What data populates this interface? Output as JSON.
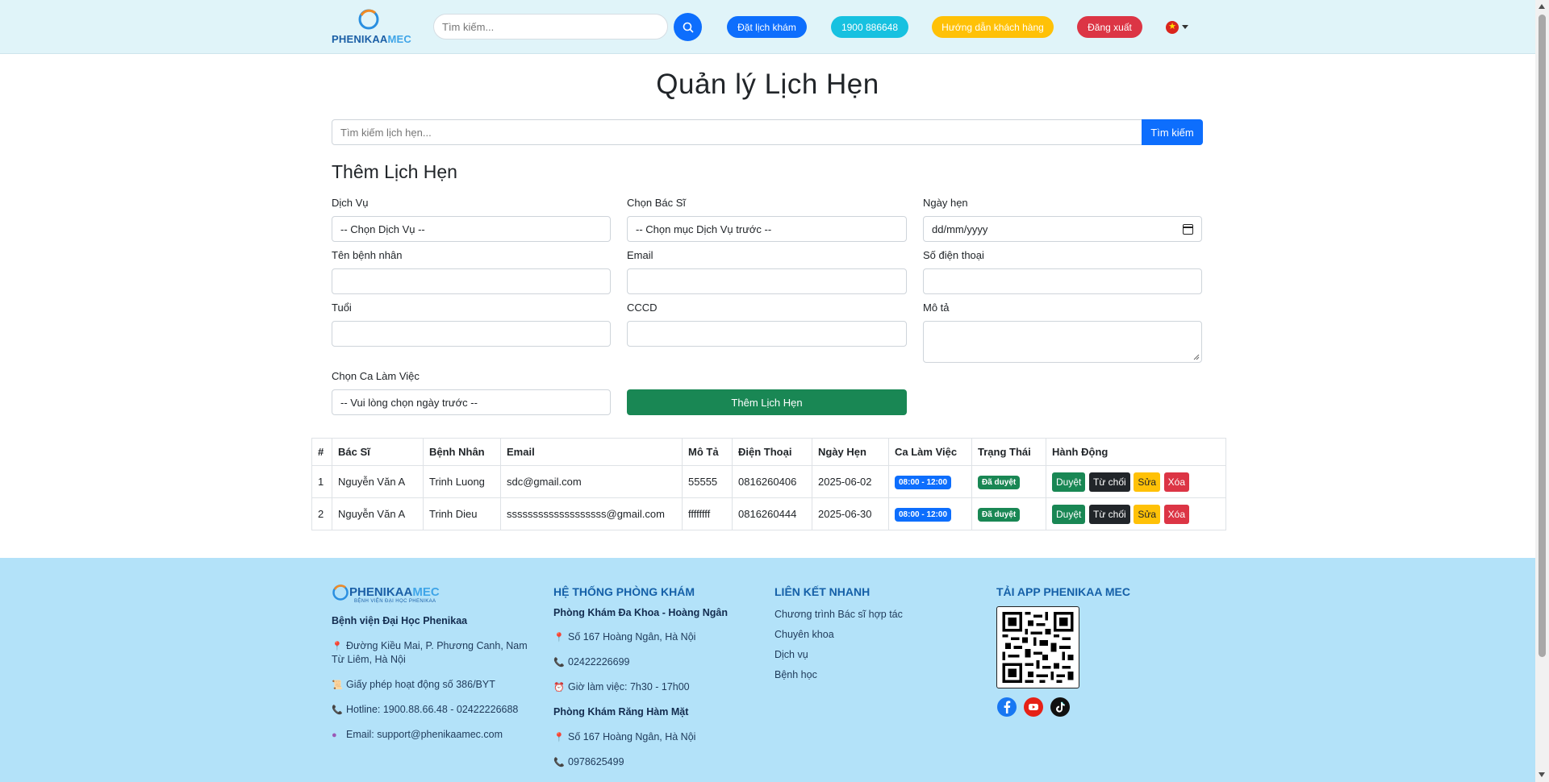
{
  "header": {
    "logo_main": "PHENIKAA",
    "logo_accent": "MEC",
    "search_placeholder": "Tìm kiếm...",
    "book_label": "Đặt lịch khám",
    "hotline_label": "1900 886648",
    "guide_label": "Hướng dẫn khách hàng",
    "logout_label": "Đăng xuất",
    "language_icon": "vietnam-flag-icon"
  },
  "page": {
    "title": "Quản lý Lịch Hẹn",
    "search_placeholder": "Tìm kiếm lịch hẹn...",
    "search_button": "Tìm kiếm"
  },
  "form": {
    "title": "Thêm Lịch Hẹn",
    "service_label": "Dịch Vụ",
    "service_value": "-- Chọn Dịch Vụ --",
    "doctor_label": "Chọn Bác Sĩ",
    "doctor_value": "-- Chọn mục Dịch Vụ trước --",
    "date_label": "Ngày hẹn",
    "date_placeholder": "dd/mm/yyyy",
    "patient_label": "Tên bệnh nhân",
    "email_label": "Email",
    "phone_label": "Số điện thoại",
    "age_label": "Tuổi",
    "cccd_label": "CCCD",
    "desc_label": "Mô tả",
    "shift_label": "Chọn Ca Làm Việc",
    "shift_value": "-- Vui lòng chọn ngày trước --",
    "submit_label": "Thêm Lịch Hẹn"
  },
  "table": {
    "headers": [
      "#",
      "Bác Sĩ",
      "Bệnh Nhân",
      "Email",
      "Mô Tả",
      "Điện Thoại",
      "Ngày Hẹn",
      "Ca Làm Việc",
      "Trạng Thái",
      "Hành Động"
    ],
    "rows": [
      {
        "num": "1",
        "doctor": "Nguyễn Văn A",
        "patient": "Trinh Luong",
        "email": "sdc@gmail.com",
        "desc": "55555",
        "phone": "0816260406",
        "date": "2025-06-02",
        "shift": "08:00 - 12:00",
        "status": "Đã duyệt"
      },
      {
        "num": "2",
        "doctor": "Nguyễn Văn A",
        "patient": "Trinh Dieu",
        "email": "sssssssssssssssssss@gmail.com",
        "desc": "ffffffff",
        "phone": "0816260444",
        "date": "2025-06-30",
        "shift": "08:00 - 12:00",
        "status": "Đã duyệt"
      }
    ],
    "actions": {
      "approve": "Duyệt",
      "reject": "Từ chối",
      "edit": "Sửa",
      "delete": "Xóa"
    }
  },
  "footer": {
    "logo_main": "PHENIKAA",
    "logo_accent": "MEC",
    "logo_sub": "BỆNH VIỆN ĐẠI HỌC PHENIKAA",
    "hospital_name": "Bệnh viện Đại Học Phenikaa",
    "address_line1": "Đường Kiều Mai, P. Phương Canh, Nam",
    "address_line2": "Từ Liêm, Hà Nội",
    "license": "Giấy phép hoạt động số 386/BYT",
    "hotline": "Hotline: 1900.88.66.48 - 02422226688",
    "email": "Email: support@phenikaamec.com",
    "clinics_heading": "HỆ THỐNG PHÒNG KHÁM",
    "clinic1_name": "Phòng Khám Đa Khoa - Hoàng Ngân",
    "clinic1_address": "Số 167 Hoàng Ngân, Hà Nội",
    "clinic1_phone": "02422226699",
    "clinic1_hours": "Giờ làm việc: 7h30 - 17h00",
    "clinic2_name": "Phòng Khám Răng Hàm Mặt",
    "clinic2_address": "Số 167 Hoàng Ngân, Hà Nội",
    "clinic2_phone": "0978625499",
    "links_heading": "LIÊN KẾT NHANH",
    "links": [
      "Chương trình Bác sĩ hợp tác",
      "Chuyên khoa",
      "Dịch vụ",
      "Bệnh học"
    ],
    "app_heading": "TẢI APP PHENIKAA MEC"
  },
  "colors": {
    "header_bg": "#e0f4f9",
    "primary": "#0d6efd",
    "success": "#198754",
    "warning": "#ffc107",
    "danger": "#dc3545",
    "footer_bg": "#b3e2f9"
  }
}
